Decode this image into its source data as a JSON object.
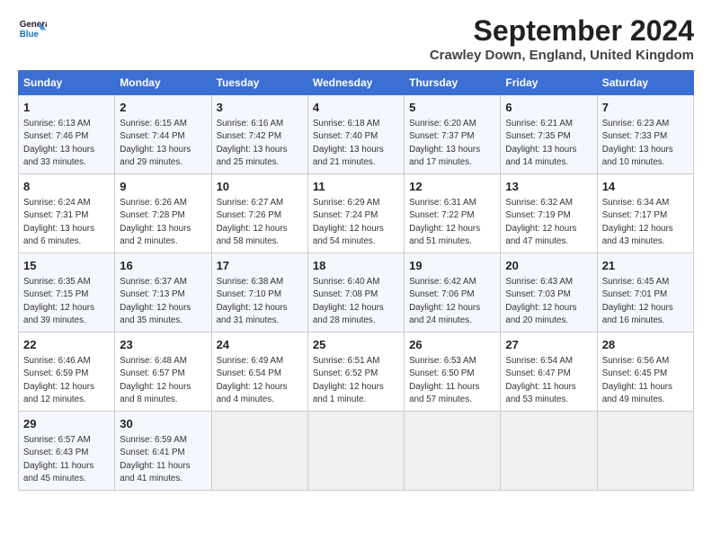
{
  "logo": {
    "line1": "General",
    "line2": "Blue"
  },
  "title": "September 2024",
  "location": "Crawley Down, England, United Kingdom",
  "days_of_week": [
    "Sunday",
    "Monday",
    "Tuesday",
    "Wednesday",
    "Thursday",
    "Friday",
    "Saturday"
  ],
  "weeks": [
    [
      {
        "day": "1",
        "info": "Sunrise: 6:13 AM\nSunset: 7:46 PM\nDaylight: 13 hours\nand 33 minutes."
      },
      {
        "day": "2",
        "info": "Sunrise: 6:15 AM\nSunset: 7:44 PM\nDaylight: 13 hours\nand 29 minutes."
      },
      {
        "day": "3",
        "info": "Sunrise: 6:16 AM\nSunset: 7:42 PM\nDaylight: 13 hours\nand 25 minutes."
      },
      {
        "day": "4",
        "info": "Sunrise: 6:18 AM\nSunset: 7:40 PM\nDaylight: 13 hours\nand 21 minutes."
      },
      {
        "day": "5",
        "info": "Sunrise: 6:20 AM\nSunset: 7:37 PM\nDaylight: 13 hours\nand 17 minutes."
      },
      {
        "day": "6",
        "info": "Sunrise: 6:21 AM\nSunset: 7:35 PM\nDaylight: 13 hours\nand 14 minutes."
      },
      {
        "day": "7",
        "info": "Sunrise: 6:23 AM\nSunset: 7:33 PM\nDaylight: 13 hours\nand 10 minutes."
      }
    ],
    [
      {
        "day": "8",
        "info": "Sunrise: 6:24 AM\nSunset: 7:31 PM\nDaylight: 13 hours\nand 6 minutes."
      },
      {
        "day": "9",
        "info": "Sunrise: 6:26 AM\nSunset: 7:28 PM\nDaylight: 13 hours\nand 2 minutes."
      },
      {
        "day": "10",
        "info": "Sunrise: 6:27 AM\nSunset: 7:26 PM\nDaylight: 12 hours\nand 58 minutes."
      },
      {
        "day": "11",
        "info": "Sunrise: 6:29 AM\nSunset: 7:24 PM\nDaylight: 12 hours\nand 54 minutes."
      },
      {
        "day": "12",
        "info": "Sunrise: 6:31 AM\nSunset: 7:22 PM\nDaylight: 12 hours\nand 51 minutes."
      },
      {
        "day": "13",
        "info": "Sunrise: 6:32 AM\nSunset: 7:19 PM\nDaylight: 12 hours\nand 47 minutes."
      },
      {
        "day": "14",
        "info": "Sunrise: 6:34 AM\nSunset: 7:17 PM\nDaylight: 12 hours\nand 43 minutes."
      }
    ],
    [
      {
        "day": "15",
        "info": "Sunrise: 6:35 AM\nSunset: 7:15 PM\nDaylight: 12 hours\nand 39 minutes."
      },
      {
        "day": "16",
        "info": "Sunrise: 6:37 AM\nSunset: 7:13 PM\nDaylight: 12 hours\nand 35 minutes."
      },
      {
        "day": "17",
        "info": "Sunrise: 6:38 AM\nSunset: 7:10 PM\nDaylight: 12 hours\nand 31 minutes."
      },
      {
        "day": "18",
        "info": "Sunrise: 6:40 AM\nSunset: 7:08 PM\nDaylight: 12 hours\nand 28 minutes."
      },
      {
        "day": "19",
        "info": "Sunrise: 6:42 AM\nSunset: 7:06 PM\nDaylight: 12 hours\nand 24 minutes."
      },
      {
        "day": "20",
        "info": "Sunrise: 6:43 AM\nSunset: 7:03 PM\nDaylight: 12 hours\nand 20 minutes."
      },
      {
        "day": "21",
        "info": "Sunrise: 6:45 AM\nSunset: 7:01 PM\nDaylight: 12 hours\nand 16 minutes."
      }
    ],
    [
      {
        "day": "22",
        "info": "Sunrise: 6:46 AM\nSunset: 6:59 PM\nDaylight: 12 hours\nand 12 minutes."
      },
      {
        "day": "23",
        "info": "Sunrise: 6:48 AM\nSunset: 6:57 PM\nDaylight: 12 hours\nand 8 minutes."
      },
      {
        "day": "24",
        "info": "Sunrise: 6:49 AM\nSunset: 6:54 PM\nDaylight: 12 hours\nand 4 minutes."
      },
      {
        "day": "25",
        "info": "Sunrise: 6:51 AM\nSunset: 6:52 PM\nDaylight: 12 hours\nand 1 minute."
      },
      {
        "day": "26",
        "info": "Sunrise: 6:53 AM\nSunset: 6:50 PM\nDaylight: 11 hours\nand 57 minutes."
      },
      {
        "day": "27",
        "info": "Sunrise: 6:54 AM\nSunset: 6:47 PM\nDaylight: 11 hours\nand 53 minutes."
      },
      {
        "day": "28",
        "info": "Sunrise: 6:56 AM\nSunset: 6:45 PM\nDaylight: 11 hours\nand 49 minutes."
      }
    ],
    [
      {
        "day": "29",
        "info": "Sunrise: 6:57 AM\nSunset: 6:43 PM\nDaylight: 11 hours\nand 45 minutes."
      },
      {
        "day": "30",
        "info": "Sunrise: 6:59 AM\nSunset: 6:41 PM\nDaylight: 11 hours\nand 41 minutes."
      },
      {
        "day": "",
        "info": ""
      },
      {
        "day": "",
        "info": ""
      },
      {
        "day": "",
        "info": ""
      },
      {
        "day": "",
        "info": ""
      },
      {
        "day": "",
        "info": ""
      }
    ]
  ]
}
